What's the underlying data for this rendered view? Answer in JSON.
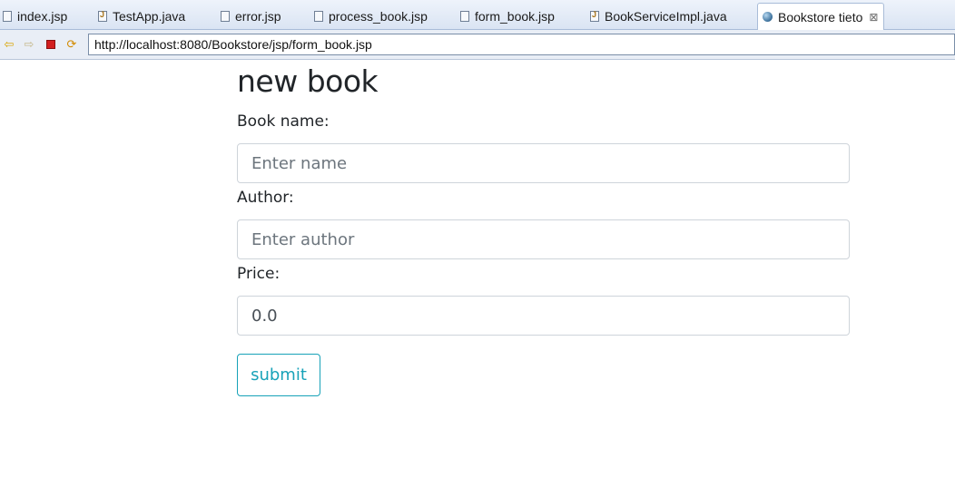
{
  "tabs": [
    {
      "label": "index.jsp",
      "icon": "jsp-file-icon"
    },
    {
      "label": "TestApp.java",
      "icon": "java-file-icon"
    },
    {
      "label": "error.jsp",
      "icon": "jsp-file-icon"
    },
    {
      "label": "process_book.jsp",
      "icon": "jsp-file-icon"
    },
    {
      "label": "form_book.jsp",
      "icon": "jsp-file-icon"
    },
    {
      "label": "BookServiceImpl.java",
      "icon": "java-file-icon"
    },
    {
      "label": "Bookstore tieto",
      "icon": "browser-globe-icon",
      "active": true,
      "close": "⊠"
    }
  ],
  "nav": {
    "url": "http://localhost:8080/Bookstore/jsp/form_book.jsp",
    "back_icon": "⇦",
    "forward_icon": "⇨",
    "refresh_icon": "⟳"
  },
  "form": {
    "title": "new book",
    "name_label": "Book name:",
    "name_placeholder": "Enter name",
    "author_label": "Author:",
    "author_placeholder": "Enter author",
    "price_label": "Price:",
    "price_value": "0.0",
    "submit_label": "submit"
  },
  "colors": {
    "accent": "#17a2b8",
    "text": "#212529",
    "input_border": "#ced4da"
  }
}
